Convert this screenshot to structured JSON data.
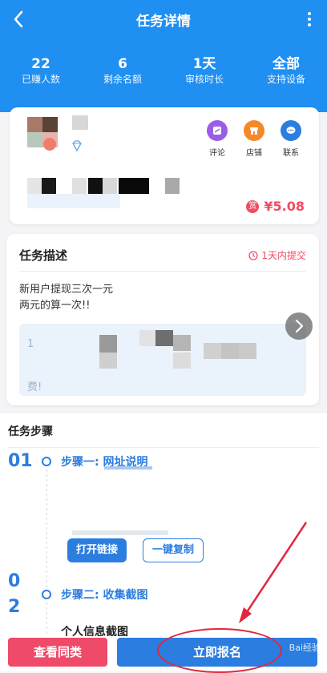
{
  "nav": {
    "title": "任务详情"
  },
  "stats": [
    {
      "value": "22",
      "label": "已赚人数"
    },
    {
      "value": "6",
      "label": "剩余名额"
    },
    {
      "value": "1天",
      "label": "审核时长"
    },
    {
      "value": "全部",
      "label": "支持设备"
    }
  ],
  "publisher": {
    "actions": [
      {
        "label": "评论",
        "color": "#9b5de5",
        "icon": "comment-icon"
      },
      {
        "label": "店铺",
        "color": "#f5892a",
        "icon": "shop-icon"
      },
      {
        "label": "联系",
        "color": "#2b7de0",
        "icon": "chat-icon"
      }
    ],
    "reward_symbol": "赏",
    "reward": "¥5.08"
  },
  "description": {
    "title": "任务描述",
    "deadline": "1天内提交",
    "lines": [
      "新用户提现三次一元",
      "两元的算一次!!"
    ],
    "box_start": "1",
    "box_end": "费!"
  },
  "steps": {
    "title": "任务步骤",
    "step1": {
      "num": "01",
      "label": "步骤一: 网址说明"
    },
    "step2": {
      "num_a": "0",
      "num_b": "2",
      "label": "步骤二: 收集截图",
      "sub": "个人信息截图"
    },
    "open_link": "打开链接",
    "copy": "一键复制"
  },
  "bottom": {
    "same_kind": "查看同类",
    "apply": "立即报名"
  },
  "watermark": "Bai经验"
}
